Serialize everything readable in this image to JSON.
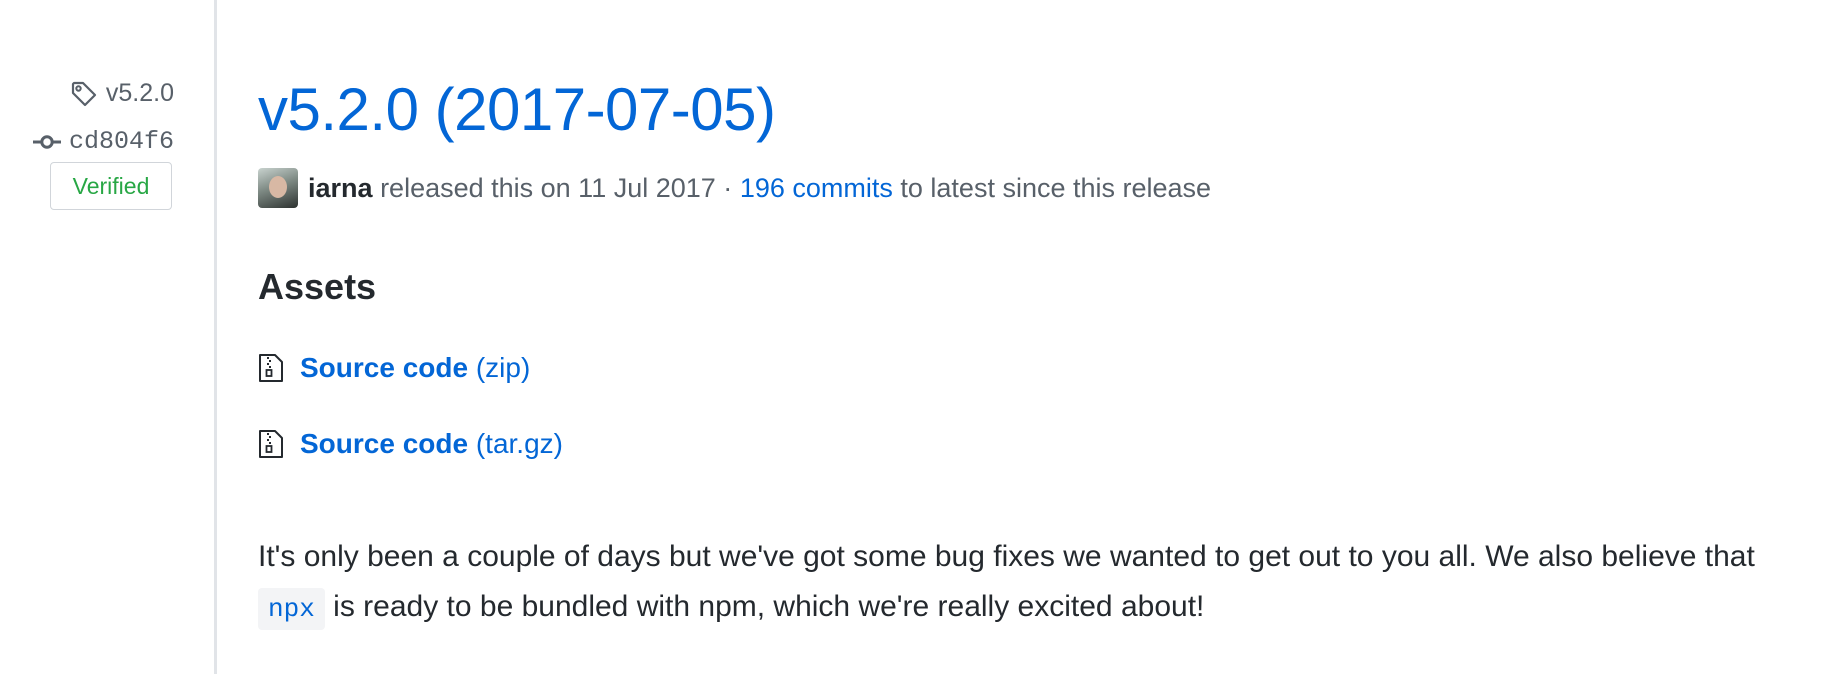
{
  "sidebar": {
    "tag_label": "v5.2.0",
    "commit_sha": "cd804f6",
    "verified_label": "Verified"
  },
  "release": {
    "title": "v5.2.0 (2017-07-05)",
    "author": "iarna",
    "released_text": "released this on 11 Jul 2017 ·",
    "commits_link": "196 commits",
    "commits_suffix": "to latest since this release"
  },
  "assets": {
    "heading": "Assets",
    "items": [
      {
        "name": "Source code",
        "ext": "(zip)"
      },
      {
        "name": "Source code",
        "ext": "(tar.gz)"
      }
    ]
  },
  "notes": {
    "line_before_code": "It's only been a couple of days but we've got some bug fixes we wanted to get out to you all. We also believe that",
    "code": "npx",
    "line_after_code": "is ready to be bundled with npm, which we're really excited about!"
  },
  "colors": {
    "link_blue": "#0366d6",
    "verified_green": "#28a745",
    "muted_text": "#586069",
    "timeline_gray": "#e1e4e8"
  },
  "icons": [
    "tag-icon",
    "git-commit-icon",
    "file-zip-icon"
  ]
}
